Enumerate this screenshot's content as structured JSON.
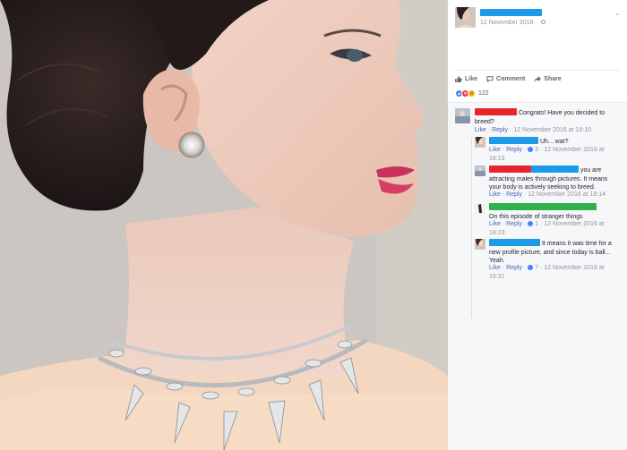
{
  "post": {
    "date": "12 November 2016 ·",
    "chevron_icon": "chevron-down-icon",
    "privacy_icon": "globe-icon"
  },
  "actions": {
    "like": "Like",
    "comment": "Comment",
    "share": "Share"
  },
  "reactions": {
    "count": "122",
    "types": [
      "like",
      "love",
      "wow"
    ]
  },
  "comments": [
    {
      "text": "Congrats! Have you decided to breed?",
      "meta_like": "Like",
      "meta_reply": "Reply",
      "meta_time": " · 12 November 2016 at 18:10"
    },
    {
      "text": "Uh... wat?",
      "meta_like": "Like",
      "meta_reply": "Reply",
      "reactions": "3",
      "meta_time": " · 12 November 2016 at 18:13"
    },
    {
      "text": "you are attracting males through pictures. It means your body is actively seeking to breed.",
      "meta_like": "Like",
      "meta_reply": "Reply",
      "meta_time": " · 12 November 2016 at 18:14"
    },
    {
      "text": "On this episode of stranger things",
      "meta_like": "Like",
      "meta_reply": "Reply",
      "reactions": "1",
      "meta_time": " · 12 November 2016 at 18:23"
    },
    {
      "text": "It means it was time for a new profile picture, and since today is ball... Yeah.",
      "meta_like": "Like",
      "meta_reply": "Reply",
      "reactions": "7",
      "meta_time": " · 12 November 2016 at 19:31"
    }
  ],
  "colors": {
    "redact_blue": "#1e9be8",
    "redact_red": "#e8242b",
    "redact_green": "#2fb24a",
    "link_blue": "#4267b2",
    "meta_gray": "#90949c"
  }
}
